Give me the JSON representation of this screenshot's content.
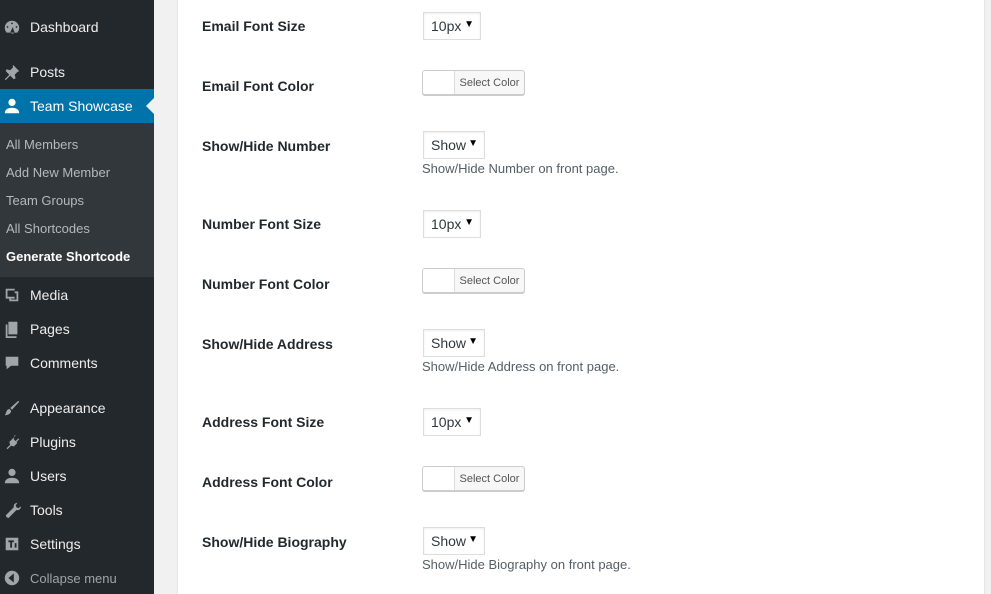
{
  "sidebar": {
    "items": [
      {
        "label": "Dashboard",
        "icon": "dashboard-icon"
      },
      {
        "label": "Posts",
        "icon": "pin-icon"
      },
      {
        "label": "Team Showcase",
        "icon": "user-icon"
      },
      {
        "label": "Media",
        "icon": "media-icon"
      },
      {
        "label": "Pages",
        "icon": "pages-icon"
      },
      {
        "label": "Comments",
        "icon": "comment-icon"
      },
      {
        "label": "Appearance",
        "icon": "brush-icon"
      },
      {
        "label": "Plugins",
        "icon": "plug-icon"
      },
      {
        "label": "Users",
        "icon": "users-icon"
      },
      {
        "label": "Tools",
        "icon": "wrench-icon"
      },
      {
        "label": "Settings",
        "icon": "settings-icon"
      }
    ],
    "submenu": [
      "All Members",
      "Add New Member",
      "Team Groups",
      "All Shortcodes",
      "Generate Shortcode"
    ],
    "collapse_label": "Collapse menu"
  },
  "form": {
    "email_font_size": {
      "label": "Email Font Size",
      "value": "10px"
    },
    "email_font_color": {
      "label": "Email Font Color",
      "button": "Select Color"
    },
    "show_number": {
      "label": "Show/Hide Number",
      "value": "Show",
      "desc": "Show/Hide Number on front page."
    },
    "number_font_size": {
      "label": "Number Font Size",
      "value": "10px"
    },
    "number_font_color": {
      "label": "Number Font Color",
      "button": "Select Color"
    },
    "show_address": {
      "label": "Show/Hide Address",
      "value": "Show",
      "desc": "Show/Hide Address on front page."
    },
    "address_font_size": {
      "label": "Address Font Size",
      "value": "10px"
    },
    "address_font_color": {
      "label": "Address Font Color",
      "button": "Select Color"
    },
    "show_biography": {
      "label": "Show/Hide Biography",
      "value": "Show",
      "desc": "Show/Hide Biography on front page."
    }
  },
  "colors": {
    "sidebar_bg": "#23282d",
    "submenu_bg": "#32373c",
    "accent": "#0073aa"
  }
}
